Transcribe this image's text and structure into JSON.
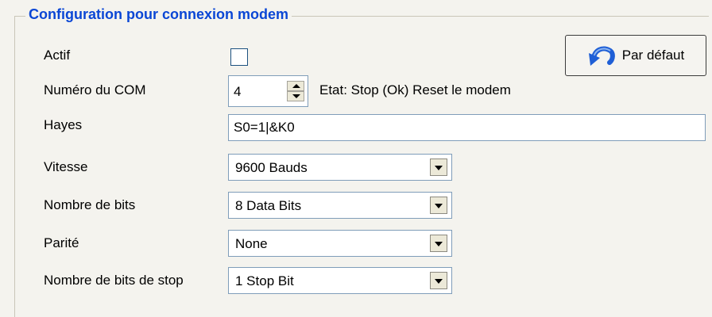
{
  "group": {
    "title": "Configuration pour connexion modem"
  },
  "fields": {
    "actif": {
      "label": "Actif",
      "checked": false
    },
    "com": {
      "label": "Numéro du COM",
      "value": "4"
    },
    "status": "Etat: Stop (Ok) Reset le modem",
    "hayes": {
      "label": "Hayes",
      "value": "S0=1|&K0"
    },
    "vitesse": {
      "label": "Vitesse",
      "value": "9600 Bauds"
    },
    "bits": {
      "label": "Nombre de bits",
      "value": "8 Data Bits"
    },
    "parite": {
      "label": "Parité",
      "value": "None"
    },
    "stop": {
      "label": "Nombre de bits de stop",
      "value": "1 Stop Bit"
    }
  },
  "default_button": {
    "label": "Par défaut",
    "icon": "undo-arrow-icon"
  },
  "colors": {
    "title": "#0a46d5",
    "background": "#f4f3ee",
    "icon": "#1f5fd6"
  }
}
